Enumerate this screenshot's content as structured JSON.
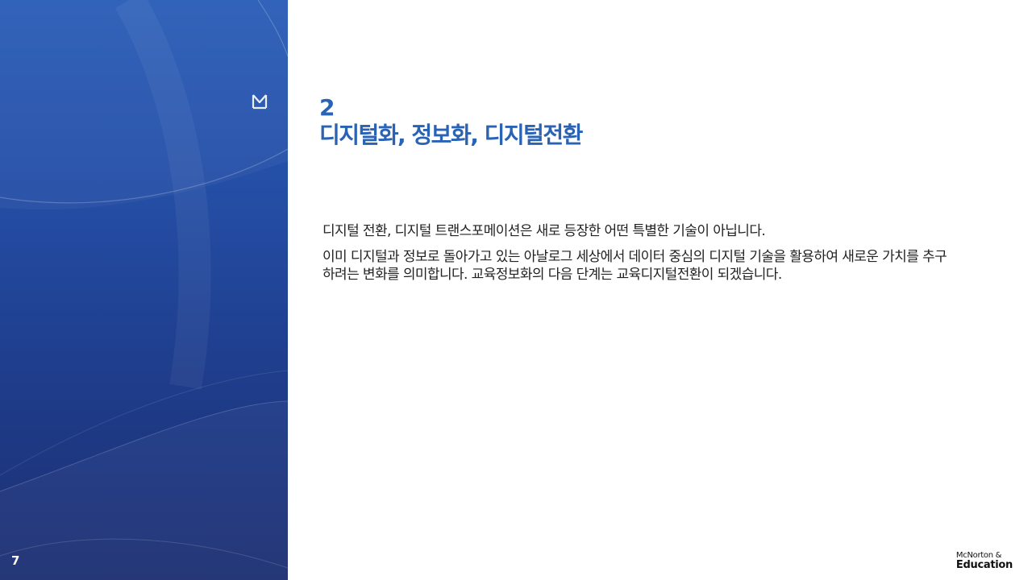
{
  "slide": {
    "page_number": "7",
    "section_number": "2",
    "title": "디지털화, 정보화, 디지털전환",
    "paragraphs": [
      "디지털 전환, 디지털 트랜스포메이션은 새로 등장한 어떤 특별한 기술이 아닙니다.",
      "이미 디지털과 정보로 돌아가고 있는 아날로그 세상에서 데이터 중심의 디지털 기술을 활용하여 새로운 가치를 추구하려는 변화를 의미합니다. 교육정보화의 다음 단계는 교육디지털전환이 되겠습니다."
    ]
  },
  "brand": {
    "line1": "McNorton &",
    "line2": "Education",
    "logo_icon": "brand-m-icon"
  },
  "colors": {
    "accent": "#2a62b4",
    "panel_top": "#2a5db8",
    "panel_bottom": "#1d2f72",
    "body_text": "#222222"
  }
}
